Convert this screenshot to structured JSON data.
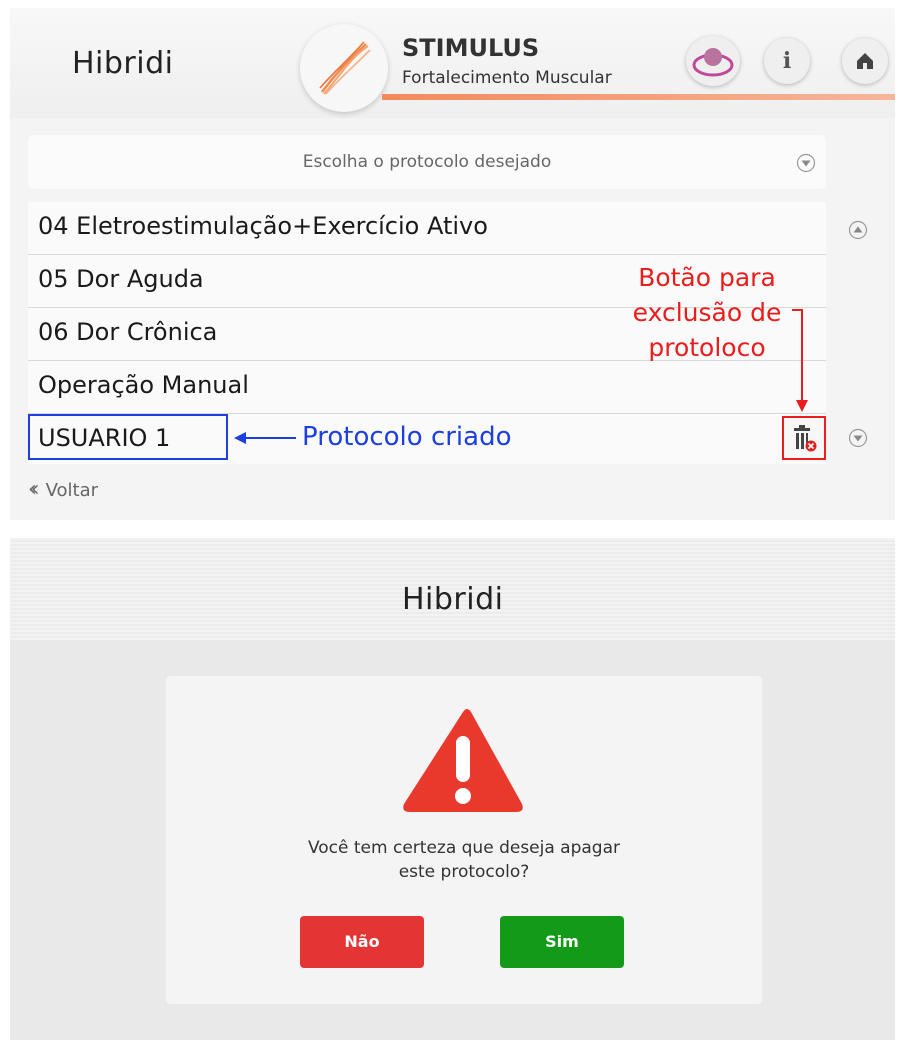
{
  "brand": "Hibridi",
  "header": {
    "title": "STIMULUS",
    "subtitle": "Fortalecimento Muscular"
  },
  "selector": {
    "placeholder": "Escolha o protocolo desejado"
  },
  "protocols": [
    "04  Eletroestimulação+Exercício Ativo",
    "05  Dor Aguda",
    "06  Dor Crônica",
    "Operação Manual",
    "USUARIO 1"
  ],
  "annotations": {
    "created_label": "Protocolo criado",
    "delete_label_line1": "Botão para",
    "delete_label_line2": "exclusão de",
    "delete_label_line3": "protoloco"
  },
  "back_label": "Voltar",
  "dialog": {
    "message_line1": "Você tem certeza que deseja apagar",
    "message_line2": "este protocolo?",
    "no_label": "Não",
    "yes_label": "Sim"
  },
  "colors": {
    "accent_orange": "#f28a5b",
    "annotation_blue": "#1e3fe0",
    "annotation_red": "#ea1c1c",
    "warning_red": "#e8392c",
    "no_button": "#e53434",
    "yes_button": "#139a19"
  },
  "icons": [
    "muscle-fiber-icon",
    "profile-icon",
    "info-icon",
    "home-icon",
    "chevron-down-icon",
    "chevron-up-icon",
    "trash-icon",
    "double-chevron-left-icon",
    "warning-icon"
  ]
}
